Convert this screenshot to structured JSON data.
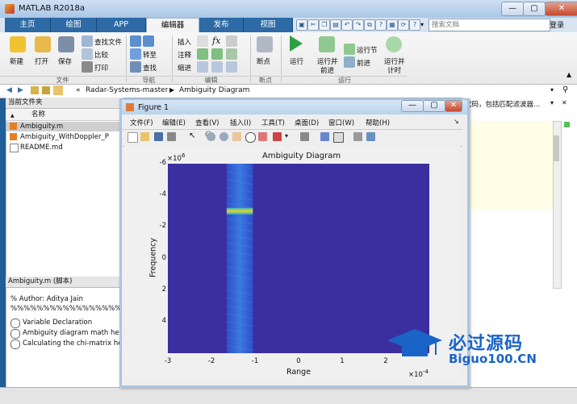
{
  "app": {
    "title": "MATLAB R2018a"
  },
  "tabs": [
    {
      "label": "主页"
    },
    {
      "label": "绘图"
    },
    {
      "label": "APP"
    },
    {
      "label": "编辑器"
    },
    {
      "label": "发布"
    },
    {
      "label": "视图"
    }
  ],
  "search": {
    "placeholder": "搜索文档"
  },
  "account": {
    "login": "登录"
  },
  "ribbon": {
    "file": {
      "new": "新建",
      "open": "打开",
      "save": "保存",
      "find_files": "查找文件",
      "compare": "比较",
      "print": "打印",
      "group": "文件"
    },
    "navigate": {
      "goto": "转至",
      "find": "查找",
      "group": "导航"
    },
    "edit": {
      "insert": "插入",
      "comment": "注释",
      "indent": "缩进",
      "fx": "fx",
      "group": "编辑"
    },
    "breakpoints": {
      "label": "断点",
      "group": "断点"
    },
    "run": {
      "run": "运行",
      "run_advance_1": "运行并",
      "run_advance_2": "前进",
      "run_section": "运行节",
      "advance": "前进",
      "run_time_1": "运行并",
      "run_time_2": "计时",
      "group": "运行"
    }
  },
  "address": {
    "sep": "«",
    "path1": "Radar-Systems-master",
    "path2": "Ambiguity Diagram"
  },
  "current_folder": {
    "title": "当前文件夹",
    "col_name": "名称",
    "sort_icon": "▲",
    "files": [
      {
        "name": "Ambiguity.m",
        "type": "m"
      },
      {
        "name": "Ambiguity_WithDoppler_P",
        "type": "m"
      },
      {
        "name": "README.md",
        "type": "md"
      }
    ]
  },
  "details": {
    "title": "Ambiguity.m  (脚本)",
    "author": "% Author: Aditya Jain",
    "percents": "%%%%%%%%%%%%%%%%%%",
    "sections": [
      "Variable Declaration",
      "Ambiguity diagram math he",
      "Calculating the chi-matrix he"
    ]
  },
  "editor": {
    "hint": "代码，包括匹配滤波器..."
  },
  "figure": {
    "title": "Figure 1",
    "menu": [
      "文件(F)",
      "编辑(E)",
      "查看(V)",
      "插入(I)",
      "工具(T)",
      "桌面(D)",
      "窗口(W)",
      "帮助(H)"
    ],
    "exponent_y": "×10",
    "exponent_y_sup": "6",
    "exponent_x": "×10",
    "exponent_x_sup": "-4"
  },
  "chart_data": {
    "type": "heatmap",
    "title": "Ambiguity Diagram",
    "xlabel": "Range",
    "ylabel": "Frequency",
    "xlim": [
      -3,
      3
    ],
    "ylim": [
      -6,
      6
    ],
    "x_ticks": [
      "-3",
      "-2",
      "-1",
      "0",
      "1",
      "2"
    ],
    "y_ticks": [
      "-6",
      "-4",
      "-2",
      "0",
      "2",
      "4"
    ],
    "y_reversed": true,
    "band_x_range": [
      -1.65,
      -1.05
    ],
    "peak_y": -3,
    "colors": {
      "background": "#3b2fa0",
      "band": "#2b63d6",
      "peak": "#e8d020"
    }
  },
  "watermark": {
    "line1": "必过源码",
    "line2": "Biguo100.CN"
  },
  "colors": {
    "accent": "#2d6aa6",
    "panel_bg": "#ffffff"
  }
}
